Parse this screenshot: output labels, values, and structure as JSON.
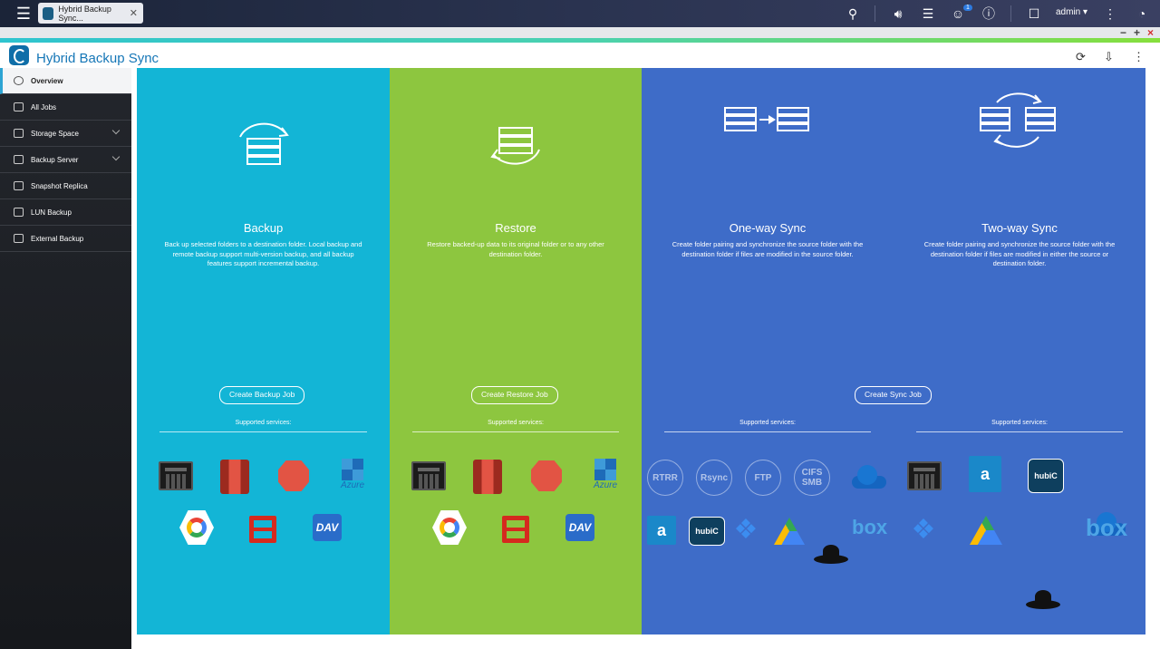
{
  "top_bar": {
    "tab_title": "Hybrid Backup Sync...",
    "notification_count": "1",
    "user": "admin"
  },
  "app": {
    "title": "Hybrid Backup Sync"
  },
  "sidebar": {
    "items": [
      {
        "label": "Overview",
        "active": true
      },
      {
        "label": "All Jobs"
      },
      {
        "label": "Storage Space",
        "expandable": true
      },
      {
        "label": "Backup Server",
        "expandable": true
      },
      {
        "label": "Snapshot Replica"
      },
      {
        "label": "LUN Backup"
      },
      {
        "label": "External Backup"
      }
    ]
  },
  "panels": {
    "backup": {
      "title": "Backup",
      "description": "Back up selected folders to a destination folder. Local backup and remote backup support multi-version backup, and all backup features support incremental backup.",
      "button": "Create Backup Job",
      "services_label": "Supported services:",
      "color": "#13b5d6"
    },
    "restore": {
      "title": "Restore",
      "description": "Restore backed-up data to its original folder or to any other destination folder.",
      "button": "Create Restore Job",
      "services_label": "Supported services:",
      "color": "#8dc63f"
    },
    "sync": {
      "color": "#3e6cc8",
      "button": "Create Sync Job",
      "oneway": {
        "title": "One-way Sync",
        "description": "Create folder pairing and synchronize the source folder with the destination folder if files are modified in the source folder.",
        "services_label": "Supported services:"
      },
      "twoway": {
        "title": "Two-way Sync",
        "description": "Create folder pairing and synchronize the source folder with the destination folder if files are modified in either the source or destination folder.",
        "services_label": "Supported services:"
      }
    }
  },
  "services": {
    "azure": "Azure",
    "dav": "DAV",
    "rtrr": "RTRR",
    "rsync": "Rsync",
    "ftp": "FTP",
    "cifs": "CIFS",
    "smb": "SMB",
    "amazon": "a",
    "hubic": "hubiC",
    "box": "box"
  }
}
